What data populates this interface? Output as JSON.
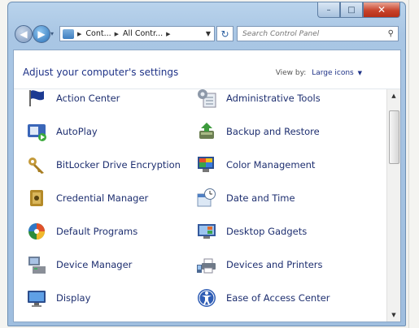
{
  "window": {
    "caption": {
      "minimize": "–",
      "maximize": "□",
      "close": "✕"
    }
  },
  "navbar": {
    "back_icon": "back-arrow-icon",
    "forward_icon": "forward-arrow-icon",
    "breadcrumbs": [
      "Cont...",
      "All Contr..."
    ],
    "search_placeholder": "Search Control Panel"
  },
  "header": {
    "title": "Adjust your computer's settings",
    "view_by_label": "View by:",
    "view_by_value": "Large icons"
  },
  "items_left": [
    {
      "label": "Action Center",
      "icon": "flag-icon"
    },
    {
      "label": "AutoPlay",
      "icon": "autoplay-icon"
    },
    {
      "label": "BitLocker Drive Encryption",
      "icon": "key-icon"
    },
    {
      "label": "Credential Manager",
      "icon": "vault-icon"
    },
    {
      "label": "Default Programs",
      "icon": "default-programs-icon"
    },
    {
      "label": "Device Manager",
      "icon": "device-manager-icon"
    },
    {
      "label": "Display",
      "icon": "display-icon"
    }
  ],
  "items_right": [
    {
      "label": "Administrative Tools",
      "icon": "admin-tools-icon"
    },
    {
      "label": "Backup and Restore",
      "icon": "backup-icon"
    },
    {
      "label": "Color Management",
      "icon": "color-management-icon"
    },
    {
      "label": "Date and Time",
      "icon": "clock-icon"
    },
    {
      "label": "Desktop Gadgets",
      "icon": "gadgets-icon"
    },
    {
      "label": "Devices and Printers",
      "icon": "printer-icon"
    },
    {
      "label": "Ease of Access Center",
      "icon": "ease-of-access-icon"
    }
  ]
}
